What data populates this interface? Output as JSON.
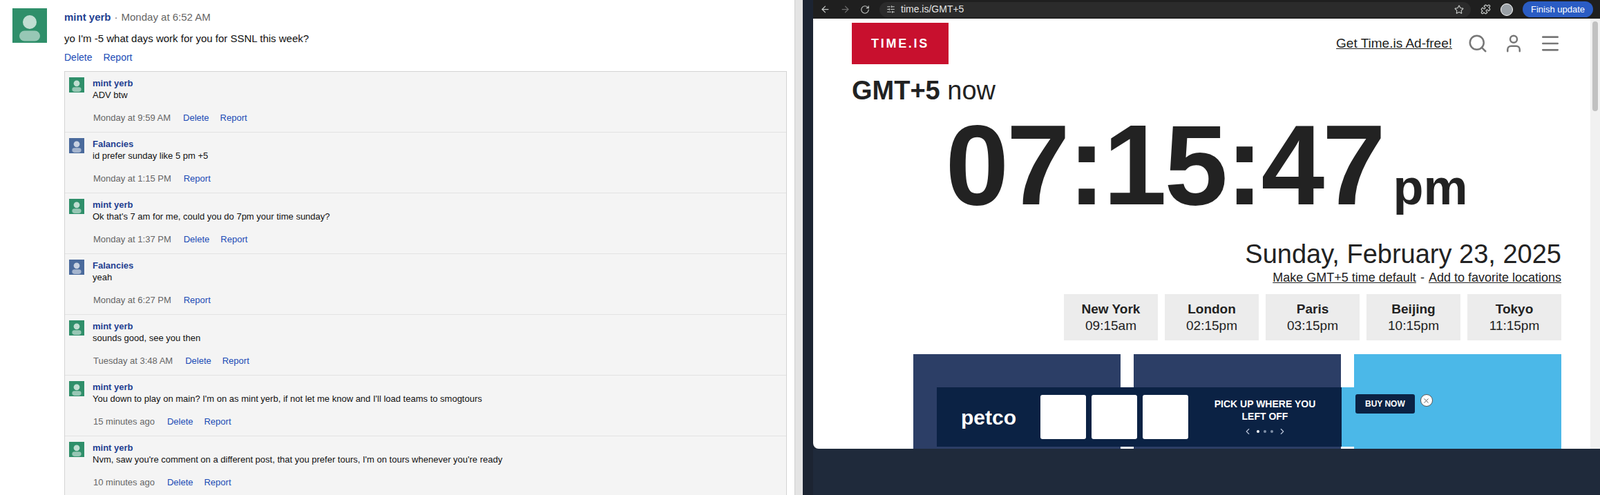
{
  "thread": {
    "post": {
      "author": "mint yerb",
      "separator": "·",
      "time": "Monday at 6:52 AM",
      "text": "yo I'm -5 what days work for you for SSNL this week?",
      "actions": [
        "Delete",
        "Report"
      ],
      "color": "#2f8f6a"
    },
    "replies": [
      {
        "author": "mint yerb",
        "text": "ADV btw",
        "time": "Monday at 9:59 AM",
        "actions": [
          "Delete",
          "Report"
        ],
        "color": "#2f8f6a"
      },
      {
        "author": "Falancies",
        "text": "id prefer sunday like 5 pm +5",
        "time": "Monday at 1:15 PM",
        "actions": [
          "Report"
        ],
        "color": "#4a6a9c"
      },
      {
        "author": "mint yerb",
        "text": "Ok that's 7 am for me, could you do 7pm your time sunday?",
        "time": "Monday at 1:37 PM",
        "actions": [
          "Delete",
          "Report"
        ],
        "color": "#2f8f6a"
      },
      {
        "author": "Falancies",
        "text": "yeah",
        "time": "Monday at 6:27 PM",
        "actions": [
          "Report"
        ],
        "color": "#4a6a9c"
      },
      {
        "author": "mint yerb",
        "text": "sounds good, see you then",
        "time": "Tuesday at 3:48 AM",
        "actions": [
          "Delete",
          "Report"
        ],
        "color": "#2f8f6a"
      },
      {
        "author": "mint yerb",
        "text": "You down to play on main? I'm on as mint yerb, if not let me know and I'll load teams to smogtours",
        "time": "15 minutes ago",
        "actions": [
          "Delete",
          "Report"
        ],
        "color": "#2f8f6a"
      },
      {
        "author": "mint yerb",
        "text": "Nvm, saw you're comment on a different post, that you prefer tours, I'm on tours whenever you're ready",
        "time": "10 minutes ago",
        "actions": [
          "Delete",
          "Report"
        ],
        "color": "#2f8f6a"
      }
    ]
  },
  "browser": {
    "url": "time.is/GMT+5",
    "update_button": "Finish update",
    "page": {
      "logo": "TIME.IS",
      "ad_free_link": "Get Time.is Ad-free!",
      "zone": "GMT+5",
      "zone_suffix": "now",
      "time": "07:15:47",
      "meridiem": "pm",
      "date": "Sunday, February 23, 2025",
      "links": [
        "Make GMT+5 time default",
        "Add to favorite locations"
      ],
      "link_separator": "-",
      "cities": [
        {
          "name": "New York",
          "time": "09:15am"
        },
        {
          "name": "London",
          "time": "02:15pm"
        },
        {
          "name": "Paris",
          "time": "03:15pm"
        },
        {
          "name": "Beijing",
          "time": "10:15pm"
        },
        {
          "name": "Tokyo",
          "time": "11:15pm"
        }
      ],
      "banner": {
        "brand": "petco",
        "headline": "PICK UP WHERE YOU LEFT OFF",
        "button": "BUY NOW"
      }
    }
  }
}
